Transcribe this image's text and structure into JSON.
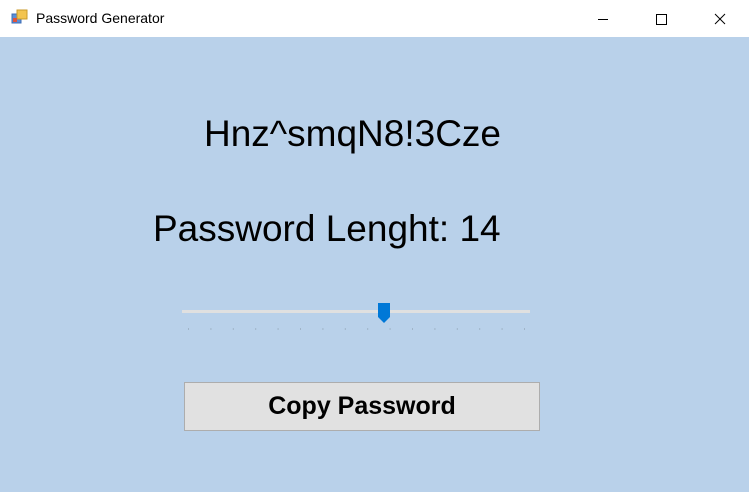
{
  "window": {
    "title": "Password Generator"
  },
  "icons": {
    "app": "app-window-icon",
    "minimize": "minimize-icon",
    "maximize": "maximize-icon",
    "close": "close-icon"
  },
  "main": {
    "password": "Hnz^smqN8!3Cze",
    "length_label": "Password Lenght: 14",
    "slider": {
      "value": 14,
      "min": 0,
      "max": 24,
      "ticks": 16,
      "track_color": "#e0e0e0",
      "thumb_color": "#0078d7"
    },
    "copy_button_label": "Copy Password"
  },
  "colors": {
    "background": "#b9d1ea",
    "button_bg": "#e1e1e1"
  }
}
